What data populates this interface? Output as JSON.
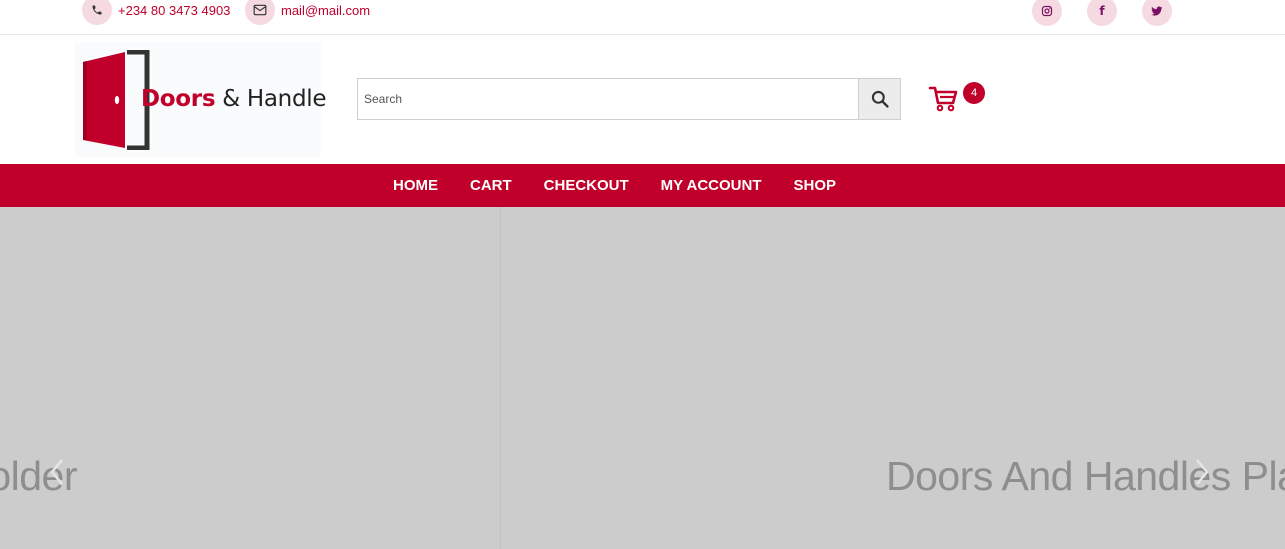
{
  "topbar": {
    "phone": "+234 80 3473 4903",
    "email": "mail@mail.com",
    "social": [
      {
        "name": "instagram-icon",
        "glyph": "◎"
      },
      {
        "name": "facebook-icon",
        "glyph": "f"
      },
      {
        "name": "twitter-icon",
        "glyph": "🐦"
      }
    ]
  },
  "header": {
    "logo": {
      "word_doors": "Doors",
      "rest": " & Handle"
    },
    "search": {
      "placeholder": "Search"
    },
    "cart": {
      "count": "4"
    }
  },
  "nav": {
    "items": [
      "HOME",
      "CART",
      "CHECKOUT",
      "MY ACCOUNT",
      "SHOP"
    ]
  },
  "slider": {
    "left_text": "Doors And Handles Placeholder",
    "right_text": "Doors And Handles Placeholder"
  },
  "colors": {
    "accent": "#c0002a",
    "icon_bg": "#f5dbe1",
    "slider_bg": "#cccccc"
  }
}
